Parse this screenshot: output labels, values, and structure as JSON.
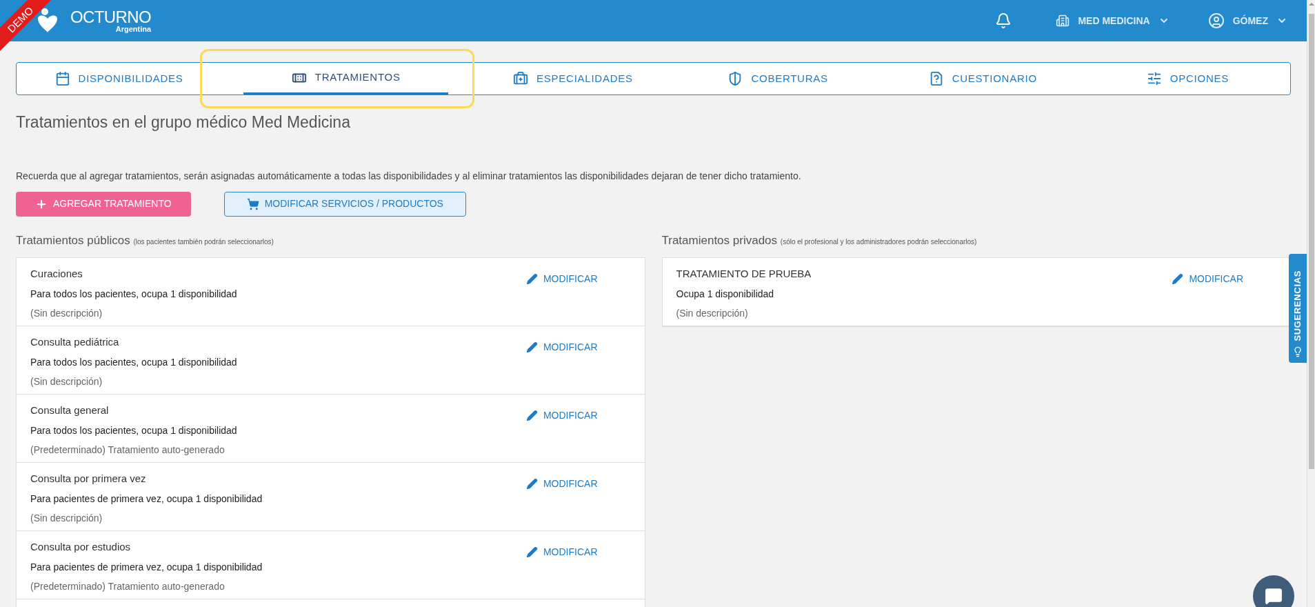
{
  "header": {
    "logo": "OCTURNO",
    "logo_sub": "Argentina",
    "ribbon": "DEMO",
    "group": "MED MEDICINA",
    "user": "GÓMEZ"
  },
  "tabs": [
    {
      "label": "DISPONIBILIDADES",
      "selected": false
    },
    {
      "label": "TRATAMIENTOS",
      "selected": true
    },
    {
      "label": "ESPECIALIDADES",
      "selected": false
    },
    {
      "label": "COBERTURAS",
      "selected": false
    },
    {
      "label": "CUESTIONARIO",
      "selected": false
    },
    {
      "label": "OPCIONES",
      "selected": false
    }
  ],
  "title": "Tratamientos en el grupo médico Med Medicina",
  "notice": "Recuerda que al agregar tratamientos, serán asignadas automáticamente a todas las disponibilidades y al eliminar tratamientos las disponibilidades dejaran de tener dicho tratamiento.",
  "buttons": {
    "add": "AGREGAR TRATAMIENTO",
    "modify": "MODIFICAR SERVICIOS / PRODUCTOS"
  },
  "lists": [
    {
      "title": "Tratamientos públicos",
      "note": "(los pacientes también podrán seleccionarlos)",
      "items": [
        {
          "name": "Curaciones",
          "detail": "Para todos los pacientes, ocupa 1 disponibilidad",
          "description": "(Sin descripción)",
          "action": "MODIFICAR"
        },
        {
          "name": "Consulta pediátrica",
          "detail": "Para todos los pacientes, ocupa 1 disponibilidad",
          "description": "(Sin descripción)",
          "action": "MODIFICAR"
        },
        {
          "name": "Consulta general",
          "detail": "Para todos los pacientes, ocupa 1 disponibilidad",
          "description": "(Predeterminado) Tratamiento auto-generado",
          "action": "MODIFICAR"
        },
        {
          "name": "Consulta por primera vez",
          "detail": "Para pacientes de primera vez, ocupa 1 disponibilidad",
          "description": "(Sin descripción)",
          "action": "MODIFICAR"
        },
        {
          "name": "Consulta por estudios",
          "detail": "Para pacientes de primera vez, ocupa 1 disponibilidad",
          "description": "(Predeterminado) Tratamiento auto-generado",
          "action": "MODIFICAR"
        }
      ],
      "more_below": true
    },
    {
      "title": "Tratamientos privados",
      "note": "(sólo el profesional y los administradores podrán seleccionarlos)",
      "items": [
        {
          "name": "TRATAMIENTO DE PRUEBA",
          "detail": "Ocupa 1 disponibilidad",
          "description": "(Sin descripción)",
          "action": "MODIFICAR"
        }
      ],
      "more_below": false
    }
  ],
  "suggestions": "SUGERENCIAS"
}
